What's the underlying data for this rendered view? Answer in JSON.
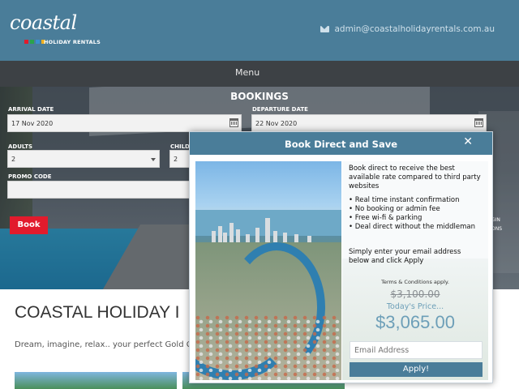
{
  "header": {
    "logo_script": "coastal",
    "logo_sub": "HOLIDAY RENTALS",
    "logo_dots": [
      "#e21b2c",
      "#2aa34a",
      "#3b8fd0",
      "#f0b020"
    ],
    "email": "admin@coastalholidayrentals.com.au"
  },
  "nav": {
    "menu_label": "Menu"
  },
  "booking": {
    "title": "BOOKINGS",
    "arrival_label": "ARRIVAL DATE",
    "arrival_value": "17 Nov 2020",
    "departure_label": "DEPARTURE DATE",
    "departure_value": "22 Nov 2020",
    "adults_label": "ADULTS",
    "adults_value": "2",
    "children_label": "CHILD",
    "children_value": "2",
    "promo_label": "PROMO CODE",
    "promo_value": "",
    "book_label": "Book",
    "side_note_1": "GIN",
    "side_note_2": "ONS"
  },
  "page": {
    "heading": "COASTAL HOLIDAY I",
    "tagline": "Dream, imagine, relax.. your perfect Gold C"
  },
  "modal": {
    "title": "Book Direct and Save",
    "close_glyph": "✕",
    "intro": "Book direct to receive the best available rate compared to third party websites",
    "bullets": [
      "• Real time instant confirmation",
      "• No booking or admin fee",
      "• Free wi-fi & parking",
      "• Deal direct without the middleman"
    ],
    "instruction": "Simply enter your email address below and click Apply",
    "terms": "Terms & Conditions apply.",
    "old_price": "$3,100.00",
    "today_label": "Today's Price...",
    "new_price": "$3,065.00",
    "email_placeholder": "Email Address",
    "apply_label": "Apply!"
  },
  "colors": {
    "header_bg": "#4a7d99",
    "nav_bg": "#3d4145",
    "book_button": "#e21b2c",
    "price_accent": "#6d9fb8"
  }
}
